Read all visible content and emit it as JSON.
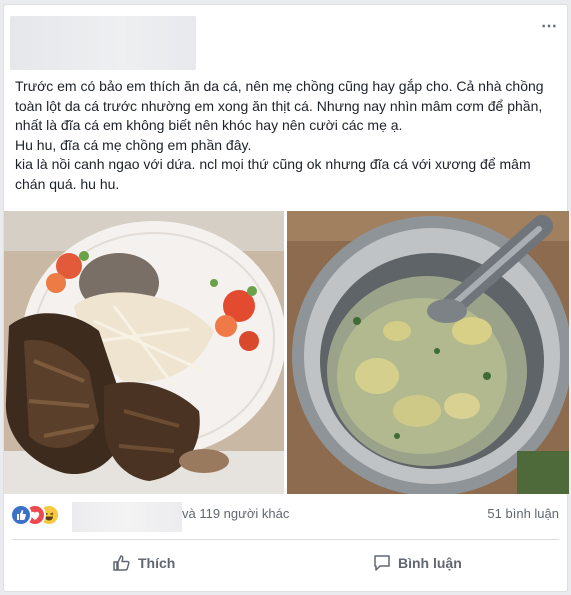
{
  "post": {
    "more_icon": "⋯",
    "paragraphs": [
      "Trước em có bảo em thích ăn da cá, nên mẹ chồng cũng hay gắp cho. Cả nhà chồng toàn lột da cá trước nhường em xong ăn thịt cá. Nhưng nay nhìn mâm cơm để phần, nhất là đĩa cá em không biết nên khóc hay nên cười các mẹ ạ.",
      "Hu hu, đĩa cá mẹ chồng em phần đây.",
      "kia là nồi canh ngao với dứa. ncl mọi thứ cũng ok nhưng đĩa cá với xương để mâm chán quá. hu hu."
    ]
  },
  "reactions": {
    "others_text": "và 119 người khác",
    "comments_text": "51 bình luận",
    "icons": [
      "like-icon",
      "love-icon",
      "haha-icon"
    ]
  },
  "actions": {
    "like_label": "Thích",
    "comment_label": "Bình luận"
  },
  "colors": {
    "like_blue": "#3b71c9",
    "love_red": "#ee4950",
    "haha_yellow": "#f7c93e",
    "text_gray": "#606770"
  }
}
